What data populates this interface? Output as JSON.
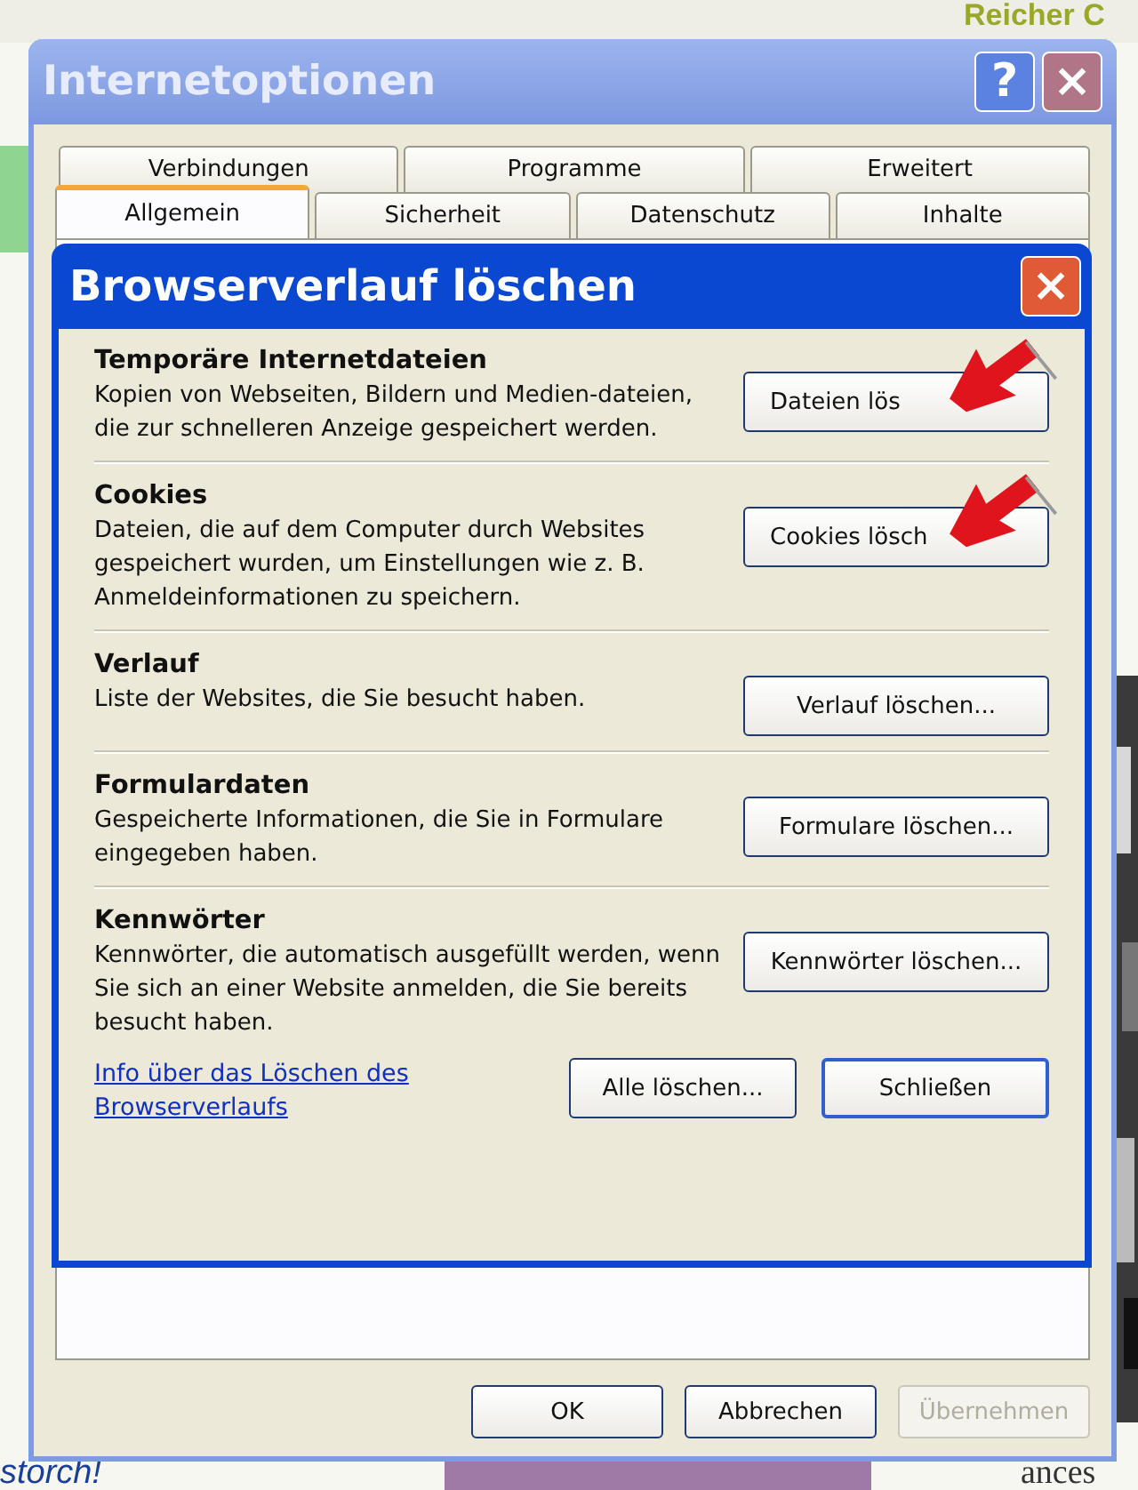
{
  "background_page": {
    "texts": [
      {
        "text": "Reicher C",
        "kind": "heading"
      },
      {
        "text": "storch!",
        "kind": "link"
      },
      {
        "text": "ances",
        "kind": "serif"
      }
    ]
  },
  "window": {
    "title": "Internetoptionen",
    "help_button": "?",
    "close_button": "×"
  },
  "tabs": [
    [
      {
        "label": "Verbindungen",
        "selected": false
      },
      {
        "label": "Programme",
        "selected": false
      },
      {
        "label": "Erweitert",
        "selected": false
      }
    ],
    [
      {
        "label": "Allgemein",
        "selected": true
      },
      {
        "label": "Sicherheit",
        "selected": false
      },
      {
        "label": "Datenschutz",
        "selected": false
      },
      {
        "label": "Inhalte",
        "selected": false
      }
    ]
  ],
  "dialog": {
    "title": "Browserverlauf löschen",
    "close_button": "×",
    "sections": [
      {
        "heading": "Temporäre Internetdateien",
        "text": "Kopien von Webseiten, Bildern und Medien-dateien, die zur schnelleren Anzeige gespeichert werden.",
        "button": "Dateien lös",
        "annotated": true
      },
      {
        "heading": "Cookies",
        "text": "Dateien, die auf dem Computer durch Websites gespeichert wurden, um Einstellungen wie z. B. Anmeldeinformationen zu speichern.",
        "button": "Cookies lösch",
        "annotated": true
      },
      {
        "heading": "Verlauf",
        "text": "Liste der Websites, die Sie besucht haben.",
        "button": "Verlauf löschen...",
        "annotated": false
      },
      {
        "heading": "Formulardaten",
        "text": "Gespeicherte Informationen, die Sie in Formulare eingegeben haben.",
        "button": "Formulare löschen...",
        "annotated": false
      },
      {
        "heading": "Kennwörter",
        "text": "Kennwörter, die automatisch ausgefüllt werden, wenn Sie sich an einer Website anmelden, die Sie bereits besucht haben.",
        "button": "Kennwörter löschen...",
        "annotated": false
      }
    ],
    "link": "Info über das Löschen des Browserverlaufs",
    "buttons": [
      {
        "label": "Alle löschen...",
        "default": false
      },
      {
        "label": "Schließen",
        "default": true
      }
    ]
  },
  "footer_buttons": [
    {
      "label": "OK",
      "disabled": false
    },
    {
      "label": "Abbrechen",
      "disabled": false
    },
    {
      "label": "Übernehmen",
      "disabled": true
    }
  ]
}
